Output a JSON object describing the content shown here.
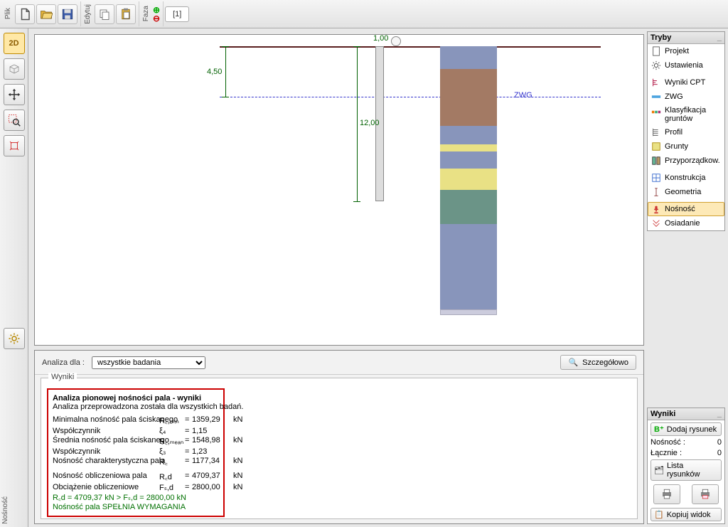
{
  "toolbar": {
    "file_label": "Plik",
    "edit_label": "Edytuj",
    "phase_label": "Faza",
    "stage": "[1]"
  },
  "left_side_label": "Nośność",
  "canvas": {
    "dim_top": "1,00",
    "dim_gw": "4,50",
    "dim_len": "12,00",
    "zwg": "ZWG",
    "soil_colors": [
      "#8895bb",
      "#a37a64",
      "#8895bb",
      "#e9e185",
      "#8895bb",
      "#e9e185",
      "#6b9487",
      "#8895bb"
    ],
    "soil_heights": [
      32,
      80,
      26,
      10,
      24,
      30,
      48,
      120
    ]
  },
  "tryby": {
    "title": "Tryby",
    "items": [
      {
        "label": "Projekt",
        "icon": "doc"
      },
      {
        "label": "Ustawienia",
        "icon": "gear"
      },
      {
        "label": "Wyniki CPT",
        "icon": "cpt"
      },
      {
        "label": "ZWG",
        "icon": "zwg"
      },
      {
        "label": "Klasyfikacja gruntów",
        "icon": "klass"
      },
      {
        "label": "Profil",
        "icon": "profil"
      },
      {
        "label": "Grunty",
        "icon": "grunty"
      },
      {
        "label": "Przyporządkow.",
        "icon": "przyp"
      },
      {
        "label": "Konstrukcja",
        "icon": "konstr"
      },
      {
        "label": "Geometria",
        "icon": "geom"
      },
      {
        "label": "Nośność",
        "icon": "nosn",
        "selected": true
      },
      {
        "label": "Osiadanie",
        "icon": "osiad"
      }
    ]
  },
  "wyniki_panel": {
    "title": "Wyniki",
    "dodaj": "Dodaj rysunek",
    "nosnosc_label": "Nośność :",
    "nosnosc_val": "0",
    "lacznie_label": "Łącznie :",
    "lacznie_val": "0",
    "lista": "Lista rysunków",
    "kopiuj": "Kopiuj widok"
  },
  "bottom": {
    "analiza_label": "Analiza dla :",
    "analiza_option": "wszystkie badania",
    "szcz": "Szczegółowo",
    "fieldset": "Wyniki",
    "title": "Analiza pionowej nośności pala - wyniki",
    "subtitle": "Analiza przeprowadzona została dla wszystkich badań.",
    "rows": [
      {
        "name": "Minimalna nośność pala ściskanego",
        "sym": "R꜀,ₘᵢₙ",
        "val": "1359,29",
        "unit": "kN"
      },
      {
        "name": "Współczynnik",
        "sym": "ξ₄",
        "val": "1,15",
        "unit": ""
      },
      {
        "name": "Średnia nośność pala ściskanego",
        "sym": "R꜀,ₘₑₐₙ",
        "val": "1548,98",
        "unit": "kN"
      },
      {
        "name": "Współczynnik",
        "sym": "ξ₃",
        "val": "1,23",
        "unit": ""
      },
      {
        "name": "Nośność charakterystyczna pala",
        "sym": "R꜀",
        "val": "1177,34",
        "unit": "kN"
      }
    ],
    "rows2": [
      {
        "name": "Nośność obliczeniowa pala",
        "sym": "R꜀d",
        "val": "4709,37",
        "unit": "kN"
      },
      {
        "name": "Obciążenie obliczeniowe",
        "sym": "Fₛ,d",
        "val": "2800,00",
        "unit": "kN"
      }
    ],
    "check": "R꜀d = 4709,37 kN > Fₛ,d = 2800,00 kN",
    "verdict": "Nośność pala SPEŁNIA WYMAGANIA"
  }
}
